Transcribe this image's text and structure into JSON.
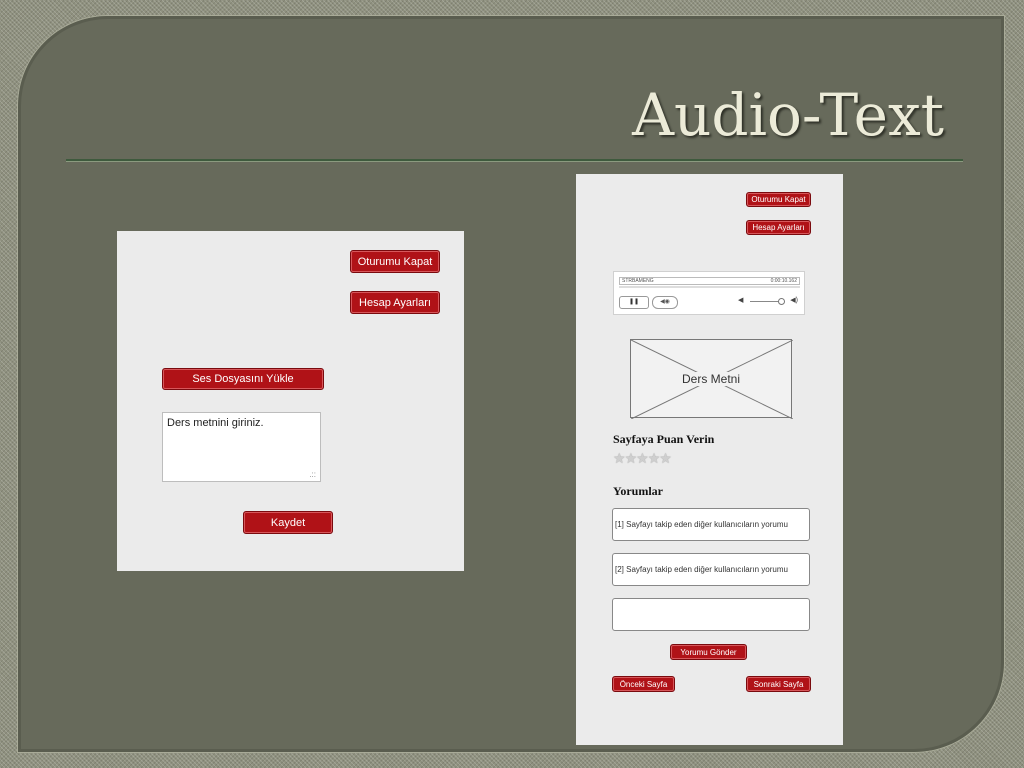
{
  "slide": {
    "title": "Audio-Text"
  },
  "left_mockup": {
    "logout_button": "Oturumu Kapat",
    "account_button": "Hesap Ayarları",
    "upload_button": "Ses Dosyasını Yükle",
    "text_input_value": "Ders metnini giriniz.",
    "save_button": "Kaydet"
  },
  "right_mockup": {
    "logout_button": "Oturumu Kapat",
    "account_button": "Hesap Ayarları",
    "player": {
      "track_name": "STRBAMENG",
      "time": "0:00:10.162"
    },
    "image_placeholder_label": "Ders Metni",
    "rating_heading": "Sayfaya Puan Verin",
    "rating": {
      "value": 0,
      "max": 5
    },
    "comments_heading": "Yorumlar",
    "comments": [
      "[1] Sayfayı takip eden diğer kullanıcıların yorumu",
      "[2] Sayfayı takip eden diğer kullanıcıların yorumu"
    ],
    "new_comment_value": "",
    "submit_comment_button": "Yorumu Gönder",
    "prev_page_button": "Önceki Sayfa",
    "next_page_button": "Sonraki Sayfa"
  }
}
